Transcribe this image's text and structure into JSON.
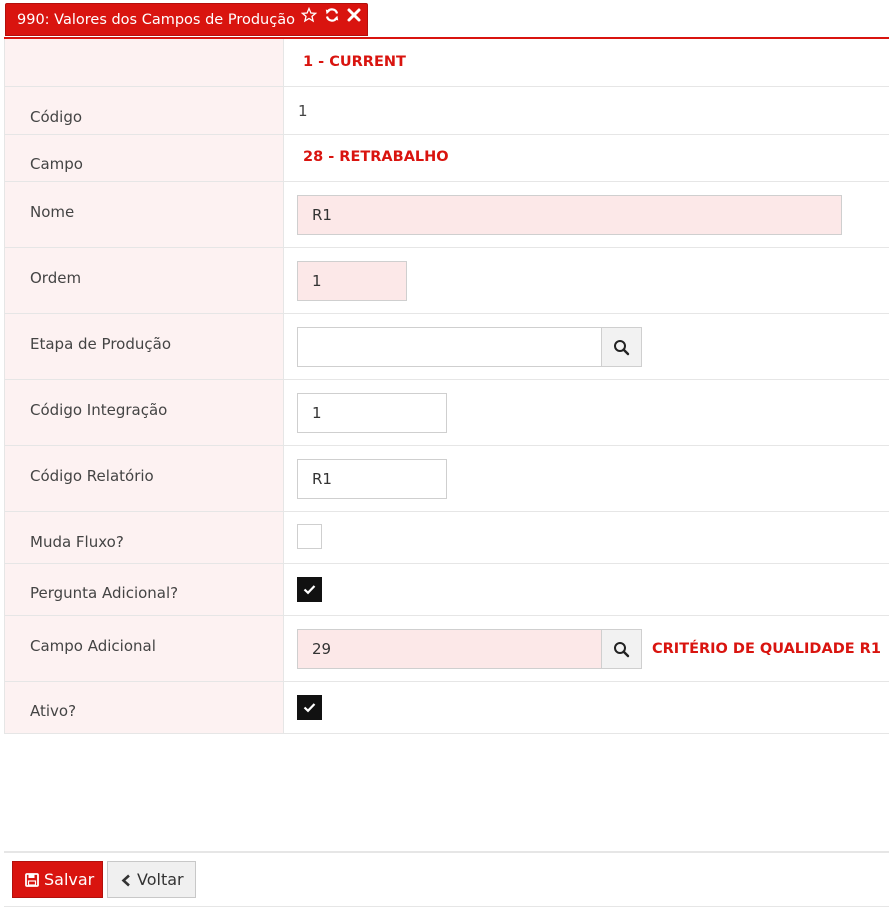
{
  "tab": {
    "title": "990: Valores dos Campos de Produção"
  },
  "header_value": "1 - CURRENT",
  "fields": {
    "codigo": {
      "label": "Código",
      "value": "1"
    },
    "campo": {
      "label": "Campo",
      "value": "28 - RETRABALHO"
    },
    "nome": {
      "label": "Nome",
      "value": "R1"
    },
    "ordem": {
      "label": "Ordem",
      "value": "1"
    },
    "etapa": {
      "label": "Etapa de Produção",
      "value": ""
    },
    "codigo_integracao": {
      "label": "Código Integração",
      "value": "1"
    },
    "codigo_relatorio": {
      "label": "Código Relatório",
      "value": "R1"
    },
    "muda_fluxo": {
      "label": "Muda Fluxo?",
      "checked": false
    },
    "pergunta_adicional": {
      "label": "Pergunta Adicional?",
      "checked": true
    },
    "campo_adicional": {
      "label": "Campo Adicional",
      "value": "29",
      "description": "CRITÉRIO DE QUALIDADE R1"
    },
    "ativo": {
      "label": "Ativo?",
      "checked": true
    }
  },
  "buttons": {
    "save": "Salvar",
    "back": "Voltar"
  },
  "icons": {
    "tab": [
      "star-icon",
      "refresh-icon",
      "close-icon"
    ],
    "lookup": "search-icon",
    "save": "floppy-icon",
    "back": "chevron-left-icon"
  },
  "colors": {
    "accent": "#d9140f",
    "label_background": "#fdf2f2",
    "required_input_background": "#fce8e8"
  }
}
